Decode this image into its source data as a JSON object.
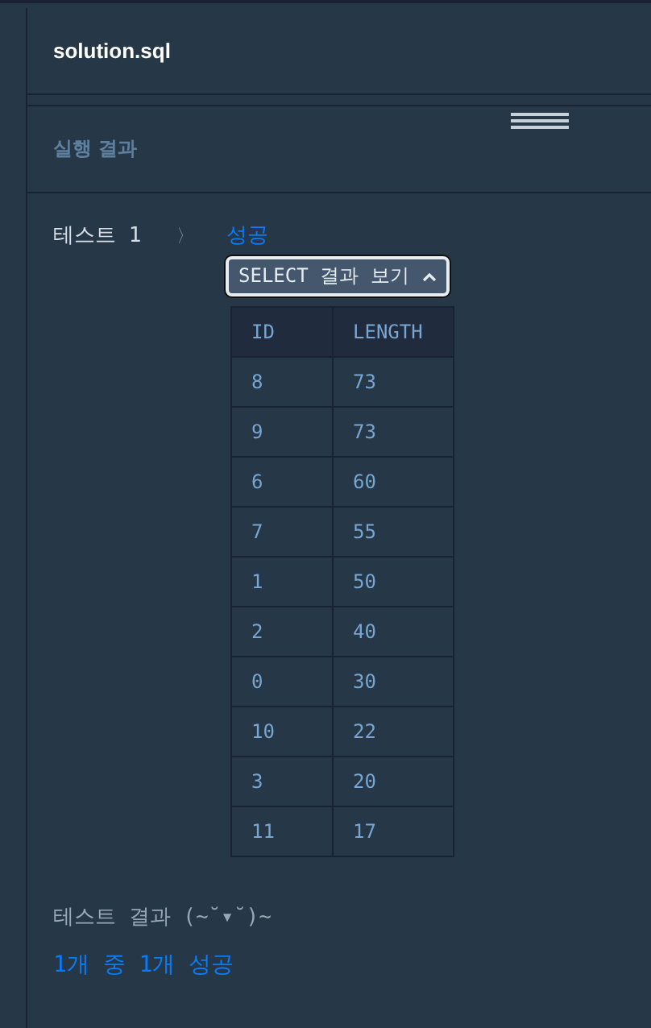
{
  "editor_tab": {
    "title": "solution.sql"
  },
  "result_panel": {
    "title": "실행 결과"
  },
  "test": {
    "label": "테스트 1",
    "separator": "〉",
    "status": "성공"
  },
  "select_toggle": {
    "label": "SELECT 결과 보기",
    "expanded": true
  },
  "table": {
    "columns": [
      "ID",
      "LENGTH"
    ],
    "rows": [
      [
        "8",
        "73"
      ],
      [
        "9",
        "73"
      ],
      [
        "6",
        "60"
      ],
      [
        "7",
        "55"
      ],
      [
        "1",
        "50"
      ],
      [
        "2",
        "40"
      ],
      [
        "0",
        "30"
      ],
      [
        "10",
        "22"
      ],
      [
        "3",
        "20"
      ],
      [
        "11",
        "17"
      ]
    ]
  },
  "summary": {
    "title": "테스트 결과 (~˘▾˘)~",
    "result": "1개 중 1개 성공"
  }
}
